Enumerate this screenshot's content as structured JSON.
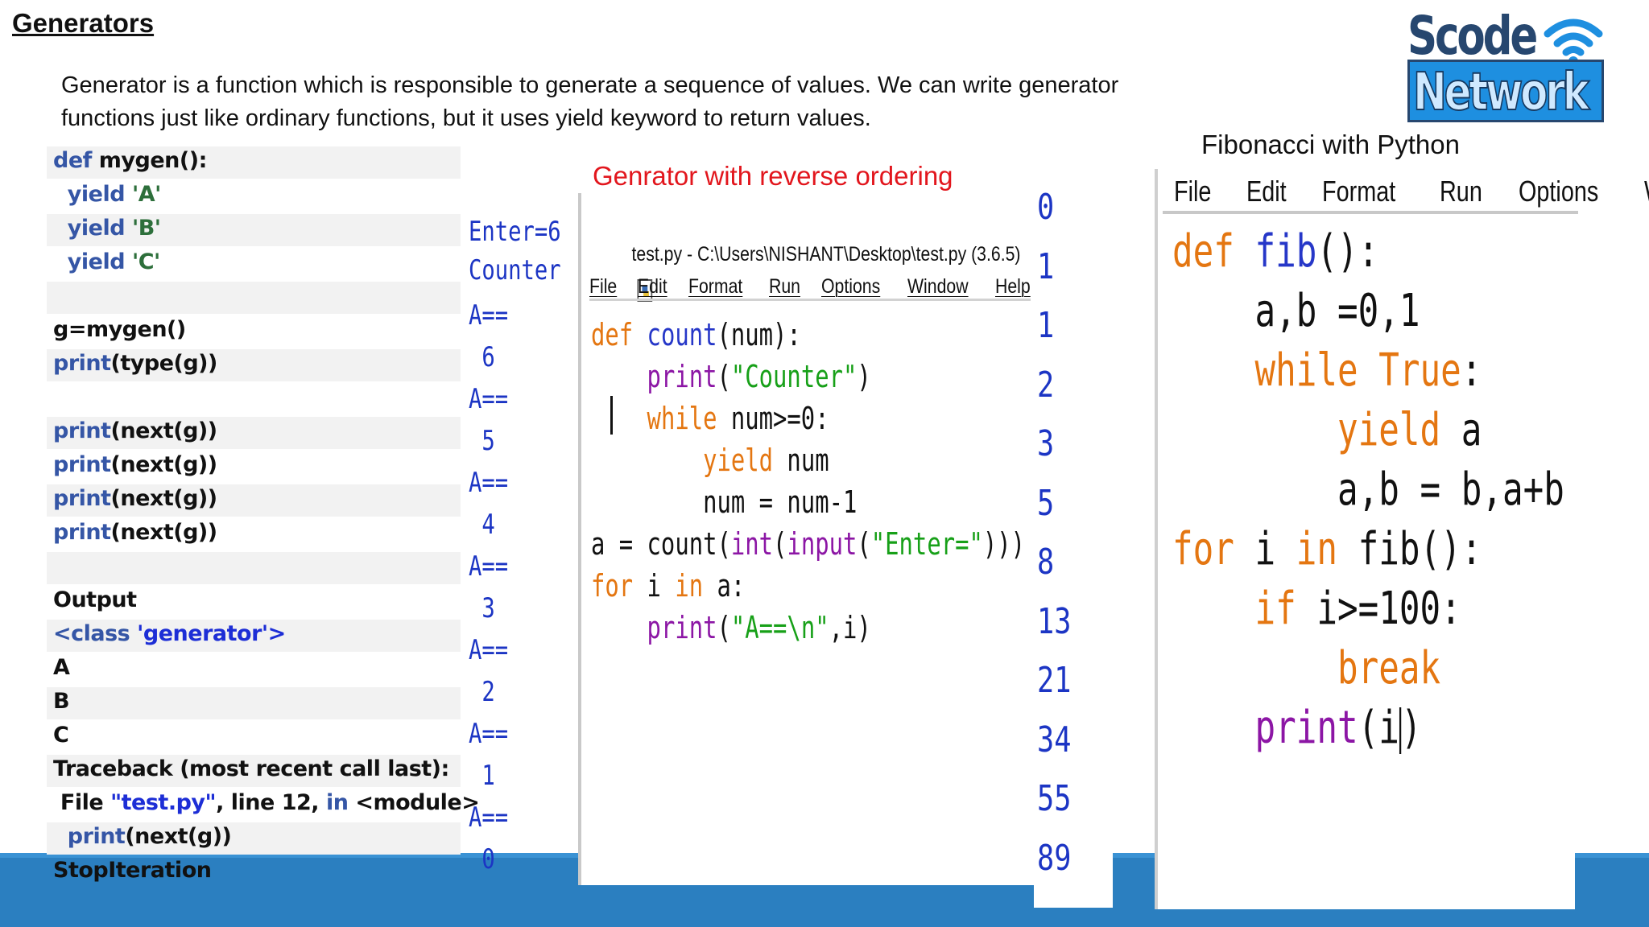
{
  "slide": {
    "heading": "Generators",
    "intro_line1": "Generator is a function which is responsible to generate a sequence of values. We can write generator",
    "intro_line2": "functions just like ordinary functions, but it uses yield keyword to return values.",
    "caption_reverse": "Genrator with reverse ordering",
    "caption_fib": "Fibonacci with Python"
  },
  "logo": {
    "line1": "Scode",
    "line2": "Network",
    "icon": "wifi-icon",
    "colors": {
      "navy": "#27476f",
      "blue": "#1e8fe0"
    }
  },
  "left_code": {
    "lines": [
      {
        "a": "def",
        "b": " mygen():"
      },
      {
        "a": "  yield",
        "b": " 'A'"
      },
      {
        "a": "  yield",
        "b": " 'B'"
      },
      {
        "a": "  yield",
        "b": " 'C'"
      },
      {
        "a": "",
        "b": ""
      },
      {
        "a": "",
        "b": "g=mygen()"
      },
      {
        "a": "print",
        "b": "(type(g))"
      },
      {
        "a": "",
        "b": ""
      },
      {
        "a": "print",
        "b": "(next(g))"
      },
      {
        "a": "print",
        "b": "(next(g))"
      },
      {
        "a": "print",
        "b": "(next(g))"
      },
      {
        "a": "print",
        "b": "(next(g))"
      },
      {
        "a": "",
        "b": ""
      },
      {
        "a": "",
        "b": "Output"
      },
      {
        "a": "<class",
        "b": " 'generator'>"
      },
      {
        "a": "",
        "b": "A"
      },
      {
        "a": "",
        "b": "B"
      },
      {
        "a": "",
        "b": "C"
      },
      {
        "a": "",
        "b": "Traceback (most recent call last):"
      },
      {
        "a": "",
        "b": " File \"test.py\", line 12, in <module>"
      },
      {
        "a": "  print",
        "b": "(next(g))"
      },
      {
        "a": "",
        "b": "StopIteration"
      }
    ]
  },
  "reverse_output": [
    "Enter=6",
    "Counter",
    "A==",
    " 6",
    "A==",
    " 5",
    "A==",
    " 4",
    "A==",
    " 3",
    "A==",
    " 2",
    "A==",
    " 1",
    "A==",
    " 0"
  ],
  "idle_window": {
    "title": "test.py - C:\\Users\\NISHANT\\Desktop\\test.py (3.6.5)",
    "menu": [
      "File",
      "Edit",
      "Format",
      "Run",
      "Options",
      "Window",
      "Help"
    ]
  },
  "reverse_code": [
    "def count(num):",
    "    print(\"Counter\")",
    "    while num>=0:",
    "        yield num",
    "        num = num-1",
    "a = count(int(input(\"Enter=\")))",
    "for i in a:",
    "    print(\"A==\\n\",i)"
  ],
  "fib_output": [
    "0",
    "1",
    "1",
    "2",
    "3",
    "5",
    "8",
    "13",
    "21",
    "34",
    "55",
    "89"
  ],
  "fib_window": {
    "menu": [
      "File",
      "Edit",
      "Format",
      "Run",
      "Options",
      "W"
    ]
  },
  "fib_code": [
    "def fib():",
    "    a,b =0,1",
    "    while True:",
    "        yield a",
    "        a,b = b,a+b",
    "for i in fib():",
    "    if i>=100:",
    "        break",
    "    print(i)"
  ]
}
